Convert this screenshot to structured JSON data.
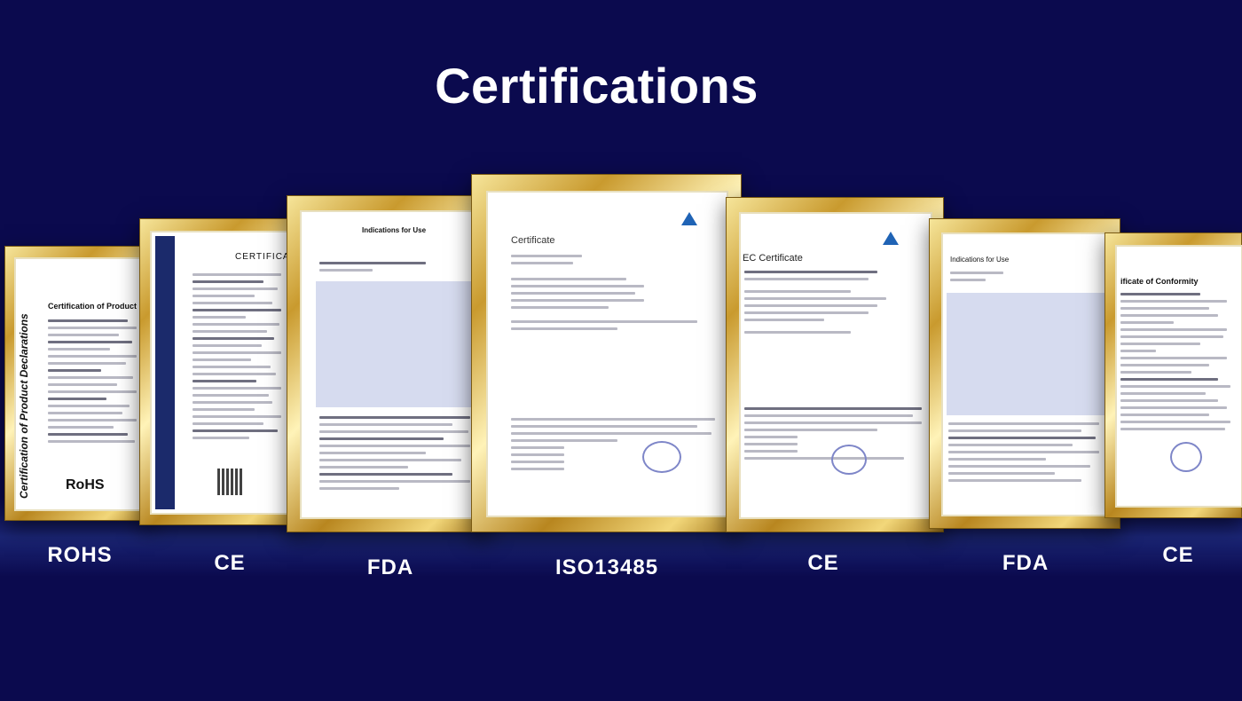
{
  "page": {
    "title": "Certifications"
  },
  "certificates": [
    {
      "caption": "ROHS",
      "doc_title": "Certification of Product Declarations",
      "side_text": "Certification of Product Declarations",
      "mark": "RoHS"
    },
    {
      "caption": "CE",
      "doc_title": "CERTIFICATE"
    },
    {
      "caption": "FDA",
      "doc_title": "Indications for Use"
    },
    {
      "caption": "ISO13485",
      "doc_title": "Certificate"
    },
    {
      "caption": "CE",
      "doc_title": "EC Certificate"
    },
    {
      "caption": "FDA",
      "doc_title": "Indications for Use"
    },
    {
      "caption": "CE",
      "doc_title": "ificate of Conformity"
    }
  ],
  "colors": {
    "background": "#0b0a4e",
    "frame_gold": "#c99a2e",
    "text": "#ffffff"
  }
}
